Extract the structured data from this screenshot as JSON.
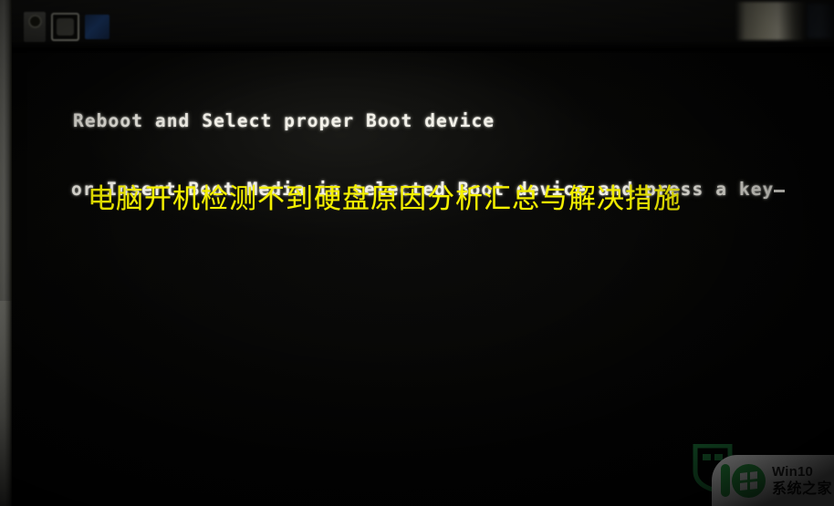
{
  "screen": {
    "kind": "bios-boot-error-screen",
    "background_color": "#000000"
  },
  "bezel": {
    "icons": [
      {
        "name": "power-button-icon",
        "label": "Power"
      },
      {
        "name": "menu-button-icon",
        "label": "Menu"
      },
      {
        "name": "status-led-icon",
        "label": "Status LED",
        "color": "#1b3a6b"
      }
    ],
    "reflection_note": ""
  },
  "bios_message": {
    "line1": "Reboot and Select proper Boot device",
    "line2": "or Insert Boot Media in selected Boot device and press a key",
    "cursor": "_",
    "text_color": "#f2f0e8"
  },
  "caption": {
    "text": "电脑开机检测不到硬盘原因分析汇总与解决措施",
    "color": "#f5f100"
  },
  "watermark": {
    "title": "Win10",
    "subtitle": "系统之家",
    "logo_digits": "10",
    "brand_color": "#2eab4a",
    "shield_color": "#1e7b3c"
  }
}
